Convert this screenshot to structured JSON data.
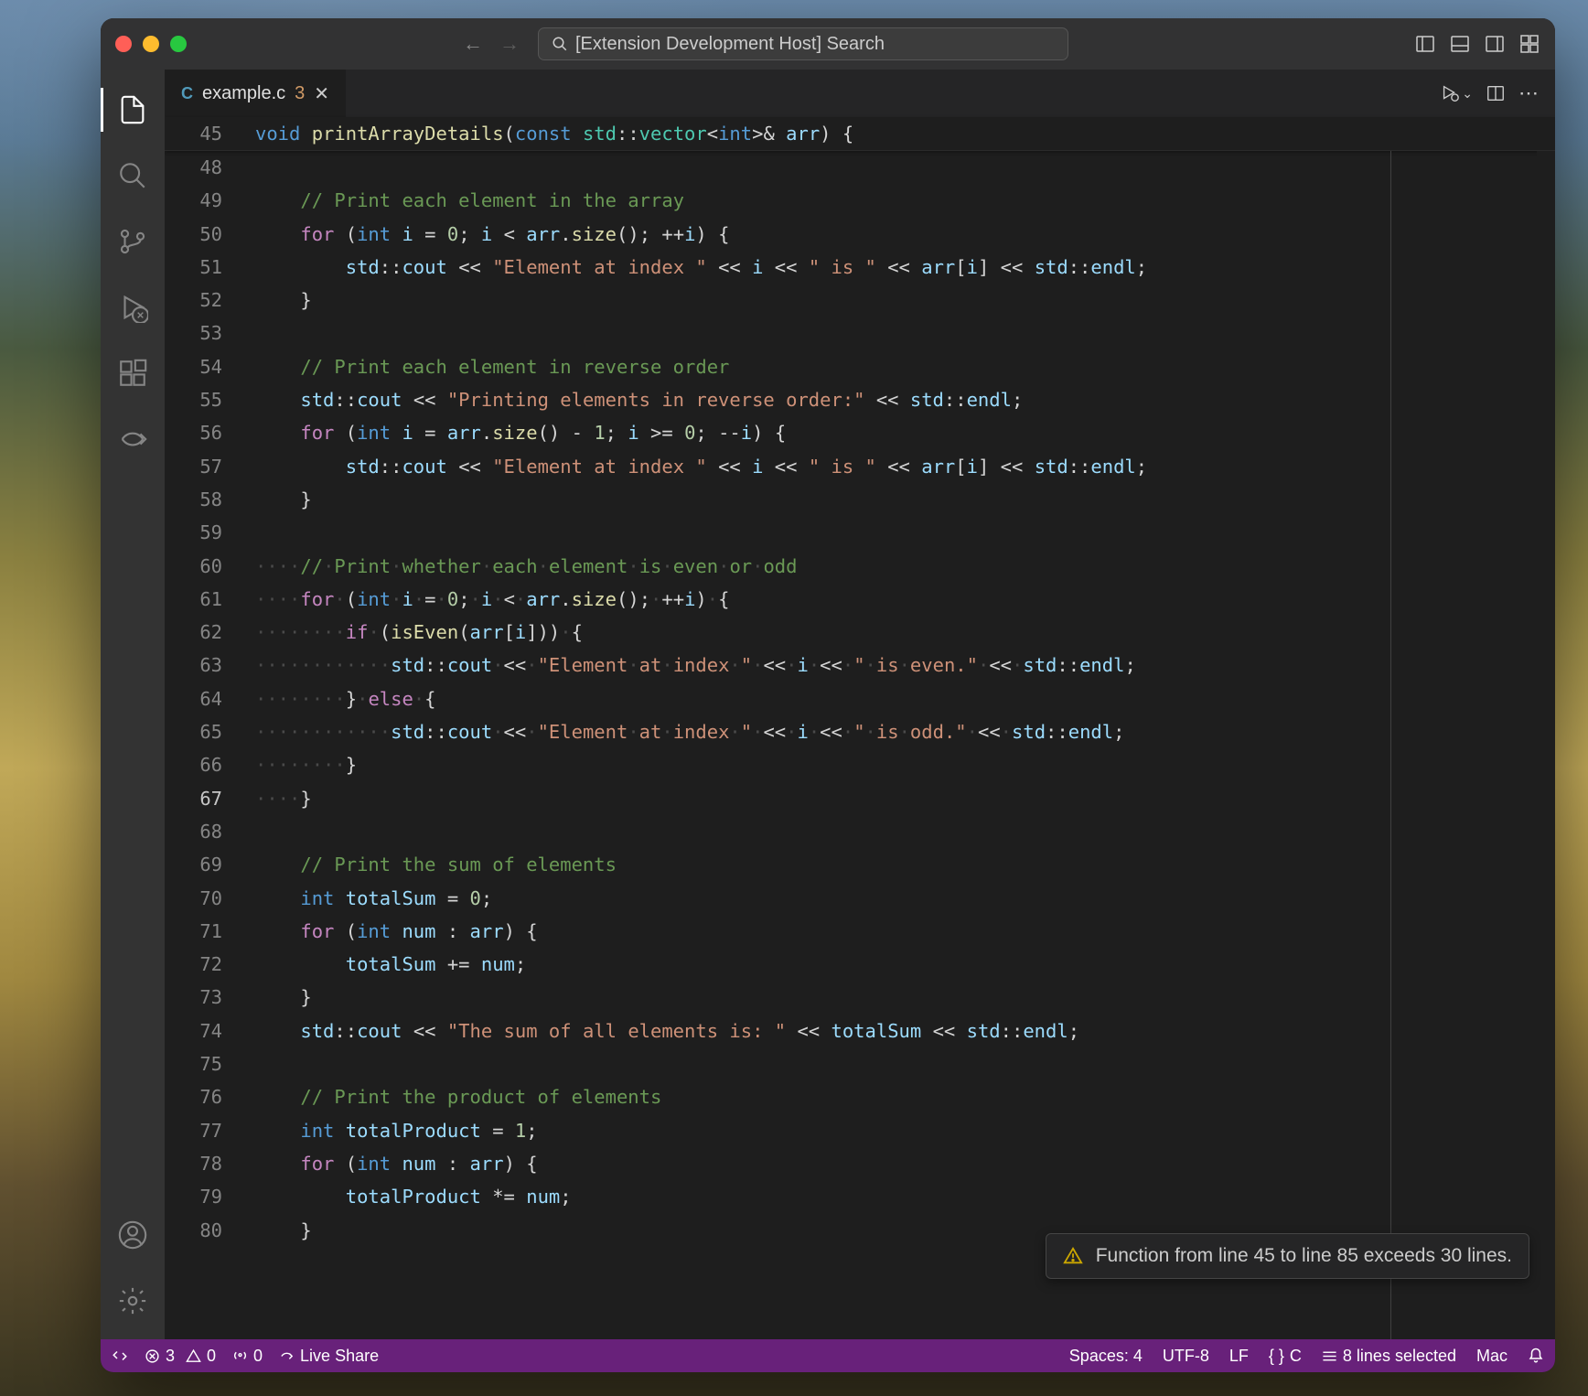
{
  "title_bar": {
    "search_placeholder": "[Extension Development Host] Search"
  },
  "tab": {
    "icon_label": "C",
    "filename": "example.c",
    "problems_count": "3"
  },
  "sticky": {
    "line_no": "45",
    "tokens": {
      "kw_void": "void",
      "fn": "printArrayDetails",
      "p_open": "(",
      "kw_const": "const",
      "std": "std",
      "colcol": "::",
      "vector": "vector",
      "lt": "<",
      "int": "int",
      "gt": ">",
      "amp": "&",
      "arr": "arr",
      "p_close": ")",
      "brace": "{"
    }
  },
  "gutter": [
    "48",
    "49",
    "50",
    "51",
    "52",
    "53",
    "54",
    "55",
    "56",
    "57",
    "58",
    "59",
    "60",
    "61",
    "62",
    "63",
    "64",
    "65",
    "66",
    "67",
    "68",
    "69",
    "70",
    "71",
    "72",
    "73",
    "74",
    "75",
    "76",
    "77",
    "78",
    "79",
    "80"
  ],
  "code": {
    "l48": "",
    "l49_cmt": "// Print each element in the array",
    "l50": {
      "for": "for",
      "int": "int",
      "i": "i",
      "eq": "=",
      "zero": "0",
      "semi": ";",
      "lt": "<",
      "arr": "arr",
      "dot": ".",
      "size": "size",
      "pp": "()",
      "inc": "++",
      "brace": "{"
    },
    "l51": {
      "std": "std",
      "cc": "::",
      "cout": "cout",
      "ll": "<<",
      "s1": "\"Element at index \"",
      "i": "i",
      "s2": "\" is \"",
      "arr": "arr",
      "lb": "[",
      "rb": "]",
      "endl": "endl",
      "semi": ";"
    },
    "l52_brace": "}",
    "l54_cmt": "// Print each element in reverse order",
    "l55": {
      "std": "std",
      "cc": "::",
      "cout": "cout",
      "ll": "<<",
      "s": "\"Printing elements in reverse order:\"",
      "endl": "endl",
      "semi": ";"
    },
    "l56": {
      "for": "for",
      "int": "int",
      "i": "i",
      "eq": "=",
      "arr": "arr",
      "dot": ".",
      "size": "size",
      "pp": "()",
      "minus": "-",
      "one": "1",
      "semi": ";",
      "ge": ">=",
      "zero": "0",
      "dec": "--",
      "brace": "{"
    },
    "l57": {
      "std": "std",
      "cc": "::",
      "cout": "cout",
      "ll": "<<",
      "s1": "\"Element at index \"",
      "i": "i",
      "s2": "\" is \"",
      "arr": "arr",
      "lb": "[",
      "rb": "]",
      "endl": "endl",
      "semi": ";"
    },
    "l58_brace": "}",
    "l60_cmt": "// Print whether each element is even or odd",
    "l60_ws": "····",
    "l61_ws": "····",
    "l61": {
      "for": "for",
      "int": "int",
      "i": "i",
      "eq": "=",
      "zero": "0",
      "semi": ";",
      "lt": "<",
      "arr": "arr",
      "dot": ".",
      "size": "size",
      "pp": "()",
      "inc": "++",
      "brace": "{"
    },
    "l62_ws": "········",
    "l62": {
      "if": "if",
      "isEven": "isEven",
      "arr": "arr",
      "lb": "[",
      "i": "i",
      "rb": "]",
      "brace": "{"
    },
    "l63_ws": "············",
    "l63": {
      "std": "std",
      "cc": "::",
      "cout": "cout",
      "ll": "<<",
      "s1": "\"Element at index \"",
      "i": "i",
      "s2": "\" is even.\"",
      "endl": "endl",
      "semi": ";"
    },
    "l64_ws": "········",
    "l64": {
      "cb": "}",
      "else": "else",
      "ob": "{"
    },
    "l65_ws": "············",
    "l65": {
      "std": "std",
      "cc": "::",
      "cout": "cout",
      "ll": "<<",
      "s1": "\"Element at index \"",
      "i": "i",
      "s2": "\" is odd.\"",
      "endl": "endl",
      "semi": ";"
    },
    "l66_ws": "········",
    "l66_brace": "}",
    "l67_ws": "····",
    "l67_brace": "}",
    "l69_cmt": "// Print the sum of elements",
    "l70": {
      "int": "int",
      "totalSum": "totalSum",
      "eq": "=",
      "zero": "0",
      "semi": ";"
    },
    "l71": {
      "for": "for",
      "int": "int",
      "num": "num",
      "colon": ":",
      "arr": "arr",
      "brace": "{"
    },
    "l72": {
      "totalSum": "totalSum",
      "pe": "+=",
      "num": "num",
      "semi": ";"
    },
    "l73_brace": "}",
    "l74": {
      "std": "std",
      "cc": "::",
      "cout": "cout",
      "ll": "<<",
      "s": "\"The sum of all elements is: \"",
      "totalSum": "totalSum",
      "endl": "endl",
      "semi": ";"
    },
    "l76_cmt": "// Print the product of elements",
    "l77": {
      "int": "int",
      "totalProduct": "totalProduct",
      "eq": "=",
      "one": "1",
      "semi": ";"
    },
    "l78": {
      "for": "for",
      "int": "int",
      "num": "num",
      "colon": ":",
      "arr": "arr",
      "brace": "{"
    },
    "l79": {
      "totalProduct": "totalProduct",
      "te": "*=",
      "num": "num",
      "semi": ";"
    },
    "l80_brace": "}"
  },
  "tooltip": {
    "text": "Function from line 45 to line 85 exceeds 30 lines."
  },
  "status": {
    "remote": "",
    "errors": "3",
    "warnings": "0",
    "ports": "0",
    "live_share": "Live Share",
    "spaces": "Spaces: 4",
    "encoding": "UTF-8",
    "eol": "LF",
    "lang_braces": "{ }",
    "lang": "C",
    "selection": "8 lines selected",
    "os": "Mac"
  }
}
